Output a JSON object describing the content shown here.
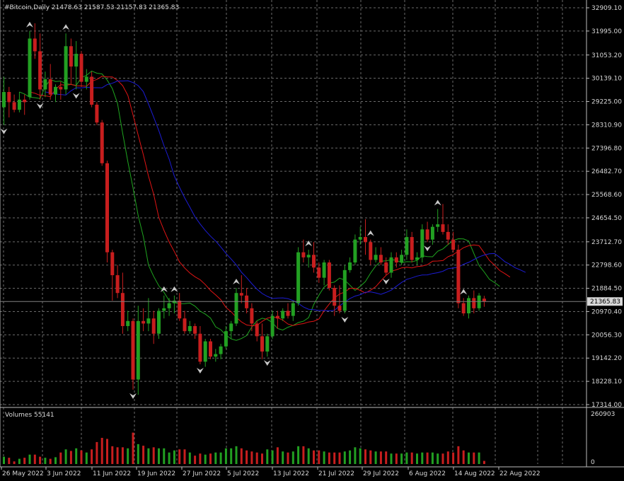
{
  "colors": {
    "background": "#000000",
    "grid": "#6b6b6b",
    "axis_text": "#d8d8d8",
    "bull": "#22a022",
    "bear": "#c81e1e",
    "ma_fast": "#1fa51f",
    "ma_mid": "#e01414",
    "ma_slow": "#1c1cd4",
    "fractal": "#c8c8c8",
    "bid_line": "#808080"
  },
  "header": {
    "title": "#Bitcoin,Daily  21478.63 21587.53 21157.83 21365.83"
  },
  "volume_panel": {
    "label": "Volumes 55141",
    "max_label": "260903",
    "zero_label": "0"
  },
  "chart_data": {
    "type": "candlestick",
    "price_axis_labels": [
      "32909.10",
      "31995.00",
      "31053.20",
      "30139.10",
      "29225.00",
      "28310.90",
      "27396.80",
      "26482.70",
      "25568.60",
      "24654.50",
      "23712.70",
      "22798.60",
      "21884.50",
      "20970.40",
      "20056.30",
      "19142.20",
      "18228.10",
      "17314.00"
    ],
    "current_price_label": "21365.83",
    "current_price": 21365.83,
    "price_range": [
      17314.0,
      32909.1
    ],
    "date_labels": [
      "26 May 2022",
      "3 Jun 2022",
      "11 Jun 2022",
      "19 Jun 2022",
      "27 Jun 2022",
      "5 Jul 2022",
      "13 Jul 2022",
      "21 Jul 2022",
      "29 Jul 2022",
      "6 Aug 2022",
      "14 Aug 2022",
      "22 Aug 2022"
    ],
    "candles": [
      {
        "o": 29000,
        "h": 30200,
        "l": 28300,
        "c": 29600
      },
      {
        "o": 29600,
        "h": 29800,
        "l": 28600,
        "c": 29200
      },
      {
        "o": 29200,
        "h": 29500,
        "l": 28800,
        "c": 28900
      },
      {
        "o": 28900,
        "h": 29600,
        "l": 28800,
        "c": 29300
      },
      {
        "o": 29300,
        "h": 29500,
        "l": 28700,
        "c": 29200
      },
      {
        "o": 29400,
        "h": 32000,
        "l": 29300,
        "c": 31700
      },
      {
        "o": 31700,
        "h": 32300,
        "l": 30900,
        "c": 31200
      },
      {
        "o": 31200,
        "h": 31900,
        "l": 29300,
        "c": 29700
      },
      {
        "o": 29700,
        "h": 30400,
        "l": 29400,
        "c": 30100
      },
      {
        "o": 30100,
        "h": 30700,
        "l": 29300,
        "c": 29500
      },
      {
        "o": 29500,
        "h": 29900,
        "l": 29200,
        "c": 29800
      },
      {
        "o": 29800,
        "h": 30000,
        "l": 29300,
        "c": 29700
      },
      {
        "o": 29700,
        "h": 31900,
        "l": 29500,
        "c": 31400
      },
      {
        "o": 31400,
        "h": 31700,
        "l": 29900,
        "c": 30600
      },
      {
        "o": 30600,
        "h": 31600,
        "l": 29700,
        "c": 31100
      },
      {
        "o": 31100,
        "h": 31200,
        "l": 29800,
        "c": 30000
      },
      {
        "o": 30000,
        "h": 30500,
        "l": 29700,
        "c": 30200
      },
      {
        "o": 30200,
        "h": 30400,
        "l": 29000,
        "c": 29100
      },
      {
        "o": 29100,
        "h": 29200,
        "l": 28300,
        "c": 28400
      },
      {
        "o": 28400,
        "h": 28500,
        "l": 26700,
        "c": 26800
      },
      {
        "o": 26800,
        "h": 26900,
        "l": 22900,
        "c": 23300
      },
      {
        "o": 23300,
        "h": 23400,
        "l": 21400,
        "c": 22400
      },
      {
        "o": 22400,
        "h": 22800,
        "l": 21500,
        "c": 21700
      },
      {
        "o": 21700,
        "h": 22500,
        "l": 20100,
        "c": 20400
      },
      {
        "o": 20400,
        "h": 21000,
        "l": 20200,
        "c": 20600
      },
      {
        "o": 20600,
        "h": 20700,
        "l": 17900,
        "c": 18300
      },
      {
        "o": 18300,
        "h": 21200,
        "l": 17700,
        "c": 20600
      },
      {
        "o": 20600,
        "h": 21100,
        "l": 20200,
        "c": 20500
      },
      {
        "o": 20500,
        "h": 21500,
        "l": 20200,
        "c": 20700
      },
      {
        "o": 20700,
        "h": 21000,
        "l": 19700,
        "c": 20100
      },
      {
        "o": 20100,
        "h": 21100,
        "l": 19900,
        "c": 21000
      },
      {
        "o": 21000,
        "h": 21600,
        "l": 20700,
        "c": 21100
      },
      {
        "o": 21100,
        "h": 21500,
        "l": 20800,
        "c": 21300
      },
      {
        "o": 21300,
        "h": 21600,
        "l": 20900,
        "c": 21400
      },
      {
        "o": 21400,
        "h": 21700,
        "l": 20600,
        "c": 20700
      },
      {
        "o": 20700,
        "h": 21000,
        "l": 20100,
        "c": 20200
      },
      {
        "o": 20200,
        "h": 20600,
        "l": 20100,
        "c": 20400
      },
      {
        "o": 20400,
        "h": 20500,
        "l": 19900,
        "c": 20100
      },
      {
        "o": 20100,
        "h": 20400,
        "l": 18900,
        "c": 19000
      },
      {
        "o": 19000,
        "h": 19900,
        "l": 18800,
        "c": 19800
      },
      {
        "o": 19800,
        "h": 19900,
        "l": 19100,
        "c": 19200
      },
      {
        "o": 19200,
        "h": 19500,
        "l": 19000,
        "c": 19300
      },
      {
        "o": 19300,
        "h": 19700,
        "l": 19100,
        "c": 19600
      },
      {
        "o": 19600,
        "h": 20400,
        "l": 19500,
        "c": 20200
      },
      {
        "o": 20200,
        "h": 20600,
        "l": 19900,
        "c": 20500
      },
      {
        "o": 20500,
        "h": 21900,
        "l": 20400,
        "c": 21700
      },
      {
        "o": 21700,
        "h": 22400,
        "l": 21300,
        "c": 21600
      },
      {
        "o": 21600,
        "h": 21900,
        "l": 20900,
        "c": 21100
      },
      {
        "o": 21100,
        "h": 21300,
        "l": 20200,
        "c": 20500
      },
      {
        "o": 20500,
        "h": 20600,
        "l": 19800,
        "c": 20000
      },
      {
        "o": 20000,
        "h": 20500,
        "l": 19100,
        "c": 19400
      },
      {
        "o": 19400,
        "h": 20100,
        "l": 19200,
        "c": 20000
      },
      {
        "o": 20000,
        "h": 21000,
        "l": 19900,
        "c": 20800
      },
      {
        "o": 20800,
        "h": 21000,
        "l": 20300,
        "c": 20700
      },
      {
        "o": 20700,
        "h": 21100,
        "l": 20600,
        "c": 21000
      },
      {
        "o": 21000,
        "h": 21300,
        "l": 20700,
        "c": 20800
      },
      {
        "o": 20800,
        "h": 21400,
        "l": 20600,
        "c": 21300
      },
      {
        "o": 21300,
        "h": 23500,
        "l": 21200,
        "c": 23300
      },
      {
        "o": 23300,
        "h": 23800,
        "l": 22900,
        "c": 23100
      },
      {
        "o": 23100,
        "h": 23400,
        "l": 22700,
        "c": 23200
      },
      {
        "o": 23200,
        "h": 23700,
        "l": 22500,
        "c": 22700
      },
      {
        "o": 22700,
        "h": 22900,
        "l": 22100,
        "c": 22300
      },
      {
        "o": 22300,
        "h": 23000,
        "l": 22000,
        "c": 22900
      },
      {
        "o": 22900,
        "h": 23000,
        "l": 21800,
        "c": 21900
      },
      {
        "o": 21900,
        "h": 22000,
        "l": 20800,
        "c": 21200
      },
      {
        "o": 21200,
        "h": 22000,
        "l": 20900,
        "c": 21000
      },
      {
        "o": 21000,
        "h": 22800,
        "l": 20900,
        "c": 22600
      },
      {
        "o": 22600,
        "h": 23100,
        "l": 22500,
        "c": 22900
      },
      {
        "o": 22900,
        "h": 24000,
        "l": 22800,
        "c": 23800
      },
      {
        "o": 23800,
        "h": 24300,
        "l": 23600,
        "c": 23900
      },
      {
        "o": 23900,
        "h": 24600,
        "l": 23200,
        "c": 23700
      },
      {
        "o": 23700,
        "h": 23800,
        "l": 22800,
        "c": 23000
      },
      {
        "o": 23000,
        "h": 23500,
        "l": 22900,
        "c": 23200
      },
      {
        "o": 23200,
        "h": 23500,
        "l": 22800,
        "c": 22900
      },
      {
        "o": 22900,
        "h": 23100,
        "l": 22400,
        "c": 22500
      },
      {
        "o": 22500,
        "h": 23300,
        "l": 22300,
        "c": 23100
      },
      {
        "o": 23100,
        "h": 23300,
        "l": 22700,
        "c": 22900
      },
      {
        "o": 22900,
        "h": 23400,
        "l": 22800,
        "c": 23200
      },
      {
        "o": 23200,
        "h": 24200,
        "l": 23000,
        "c": 23900
      },
      {
        "o": 23900,
        "h": 24100,
        "l": 22900,
        "c": 23000
      },
      {
        "o": 23000,
        "h": 23300,
        "l": 22800,
        "c": 23100
      },
      {
        "o": 23100,
        "h": 24400,
        "l": 22900,
        "c": 24200
      },
      {
        "o": 24200,
        "h": 24500,
        "l": 23700,
        "c": 23800
      },
      {
        "o": 23800,
        "h": 24400,
        "l": 23600,
        "c": 24300
      },
      {
        "o": 24300,
        "h": 25000,
        "l": 24100,
        "c": 24400
      },
      {
        "o": 24400,
        "h": 25200,
        "l": 24000,
        "c": 24100
      },
      {
        "o": 24100,
        "h": 24400,
        "l": 23600,
        "c": 23800
      },
      {
        "o": 23800,
        "h": 24100,
        "l": 23300,
        "c": 23400
      },
      {
        "o": 23400,
        "h": 23600,
        "l": 21100,
        "c": 21300
      },
      {
        "o": 21300,
        "h": 21500,
        "l": 20800,
        "c": 20900
      },
      {
        "o": 20900,
        "h": 21600,
        "l": 20700,
        "c": 21500
      },
      {
        "o": 21500,
        "h": 21800,
        "l": 20900,
        "c": 21100
      },
      {
        "o": 21100,
        "h": 21700,
        "l": 21000,
        "c": 21600
      },
      {
        "o": 21478.63,
        "h": 21587.53,
        "l": 21157.83,
        "c": 21365.83
      }
    ],
    "volumes": [
      0.14,
      0.12,
      0.05,
      0.1,
      0.12,
      0.18,
      0.18,
      0.14,
      0.12,
      0.1,
      0.13,
      0.22,
      0.28,
      0.25,
      0.3,
      0.26,
      0.22,
      0.28,
      0.42,
      0.5,
      0.48,
      0.34,
      0.32,
      0.32,
      0.3,
      0.6,
      0.38,
      0.35,
      0.3,
      0.32,
      0.3,
      0.3,
      0.22,
      0.26,
      0.28,
      0.28,
      0.22,
      0.16,
      0.2,
      0.18,
      0.2,
      0.22,
      0.22,
      0.3,
      0.3,
      0.34,
      0.3,
      0.26,
      0.24,
      0.22,
      0.2,
      0.28,
      0.26,
      0.32,
      0.24,
      0.22,
      0.24,
      0.34,
      0.34,
      0.3,
      0.26,
      0.26,
      0.24,
      0.22,
      0.22,
      0.22,
      0.24,
      0.26,
      0.32,
      0.3,
      0.28,
      0.26,
      0.24,
      0.24,
      0.24,
      0.2,
      0.2,
      0.2,
      0.22,
      0.22,
      0.2,
      0.22,
      0.22,
      0.22,
      0.2,
      0.2,
      0.24,
      0.22,
      0.34,
      0.26,
      0.22,
      0.22,
      0.22,
      0.06
    ],
    "fractals_up": [
      5,
      12,
      31,
      33,
      45,
      59,
      71,
      84,
      89,
      95
    ],
    "fractals_down": [
      0,
      7,
      14,
      25,
      38,
      51,
      66,
      74,
      82,
      96
    ]
  }
}
